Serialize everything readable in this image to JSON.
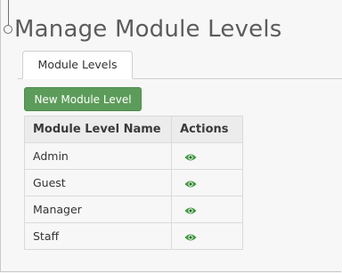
{
  "page": {
    "title": "Manage Module Levels"
  },
  "tabs": [
    {
      "label": "Module Levels",
      "active": true
    }
  ],
  "toolbar": {
    "new_label": "New Module Level"
  },
  "table": {
    "columns": [
      "Module Level Name",
      "Actions"
    ],
    "rows": [
      {
        "name": "Admin",
        "action_icon": "eye-icon"
      },
      {
        "name": "Guest",
        "action_icon": "eye-icon"
      },
      {
        "name": "Manager",
        "action_icon": "eye-icon"
      },
      {
        "name": "Staff",
        "action_icon": "eye-icon"
      }
    ]
  },
  "colors": {
    "accent_green": "#5c9c5a",
    "eye_icon": "#3f9a3f",
    "title_text": "#5c5c5c"
  }
}
